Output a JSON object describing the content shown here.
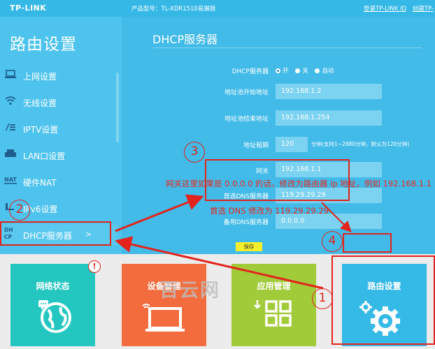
{
  "header": {
    "logo": "TP-LINK",
    "model": "产品型号：TL-XDR1510易展版",
    "links": [
      "登录TP-LINK ID",
      "创建TP-"
    ]
  },
  "sidebar": {
    "title": "路由设置",
    "items": [
      {
        "label": "上网设置",
        "icon": "laptop-icon"
      },
      {
        "label": "无线设置",
        "icon": "wifi-icon"
      },
      {
        "label": "IPTV设置",
        "icon": "iptv-icon"
      },
      {
        "label": "LAN口设置",
        "icon": "lan-icon"
      },
      {
        "label": "硬件NAT",
        "icon": "nat-icon"
      },
      {
        "label": "IPv6设置",
        "icon": "ipv6-icon"
      },
      {
        "label": "DHCP服务器",
        "icon": "dhcp-icon",
        "chevron": ">"
      }
    ]
  },
  "main": {
    "title": "DHCP服务器",
    "dhcp_label": "DHCP服务器",
    "dhcp_options": [
      "开",
      "关",
      "自动"
    ],
    "dhcp_selected": "开",
    "pool_start_label": "地址池开始地址",
    "pool_start_value": "192.168.1.2",
    "pool_end_label": "地址池结束地址",
    "pool_end_value": "192.168.1.254",
    "lease_label": "地址租期",
    "lease_value": "120",
    "lease_hint": "分钟(支持1~2880分钟，默认为120分钟)",
    "gateway_label": "网关",
    "gateway_value": "192.168.1.1",
    "dns1_label": "首选DNS服务器",
    "dns1_value": "119.29.29.29",
    "dns2_label": "备用DNS服务器",
    "dns2_value": "0.0.0.0",
    "save_label": "保存"
  },
  "tiles": [
    {
      "label": "网络状态",
      "color": "#23c7c0",
      "badge": "!"
    },
    {
      "label": "设备管理",
      "color": "#f26c3d"
    },
    {
      "label": "应用管理",
      "color": "#a2cb3a"
    },
    {
      "label": "路由设置",
      "color": "#35b9e6"
    }
  ],
  "annotations": {
    "gateway_note": "网关这里如果是 0.0.0.0 的话，修改为路由器 ip 地址，例如 192.168.1.1",
    "dns_note": "首选 DNS 修改为 119.29.29.29",
    "step1": "1",
    "step2": "2",
    "step3": "3",
    "step4": "4",
    "watermark": "百云网"
  },
  "colors": {
    "accent": "#35b8e6",
    "annotation": "#e2241c",
    "save_button": "#f5f02b"
  }
}
